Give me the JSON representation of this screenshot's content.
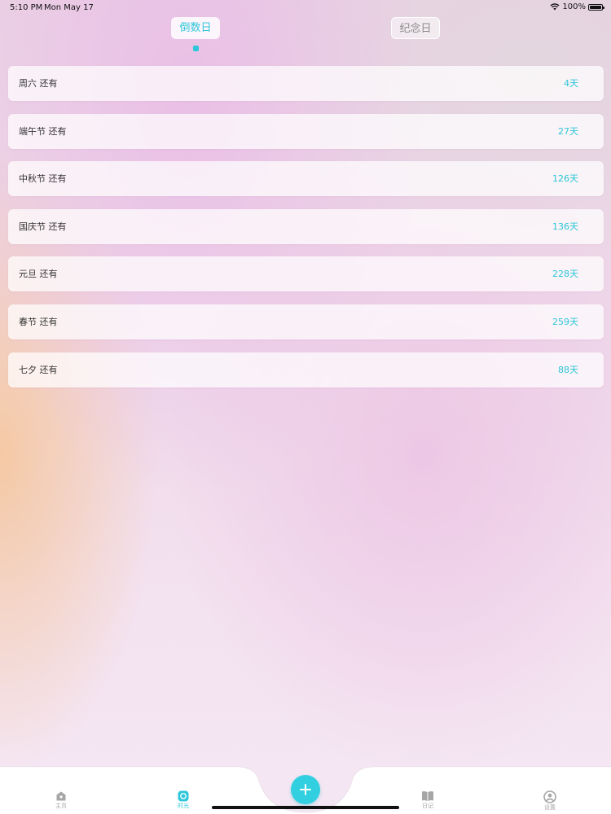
{
  "status_bar": {
    "time": "5:10 PM",
    "date": "Mon May 17",
    "battery": "100%",
    "icons": [
      "wifi-icon",
      "battery-icon"
    ]
  },
  "segment": {
    "countdown_label": "倒数日",
    "anniversary_label": "纪念日",
    "selected": "countdown"
  },
  "events": [
    {
      "name": "周六 还有",
      "days": "4天"
    },
    {
      "name": "端午节 还有",
      "days": "27天"
    },
    {
      "name": "中秋节 还有",
      "days": "126天"
    },
    {
      "name": "国庆节 还有",
      "days": "136天"
    },
    {
      "name": "元旦 还有",
      "days": "228天"
    },
    {
      "name": "春节 还有",
      "days": "259天"
    },
    {
      "name": "七夕 还有",
      "days": "88天"
    }
  ],
  "tabbar": {
    "items": [
      {
        "label": "主页",
        "icon": "home-icon",
        "active": false
      },
      {
        "label": "时光",
        "icon": "clock-icon",
        "active": true
      },
      {
        "label": "日记",
        "icon": "diary-icon",
        "active": false
      },
      {
        "label": "设置",
        "icon": "profile-icon",
        "active": false
      }
    ],
    "add_icon": "plus-icon"
  },
  "colors": {
    "accent": "#2ec6d9",
    "inactive": "#a6a6a6",
    "text": "#333333"
  }
}
